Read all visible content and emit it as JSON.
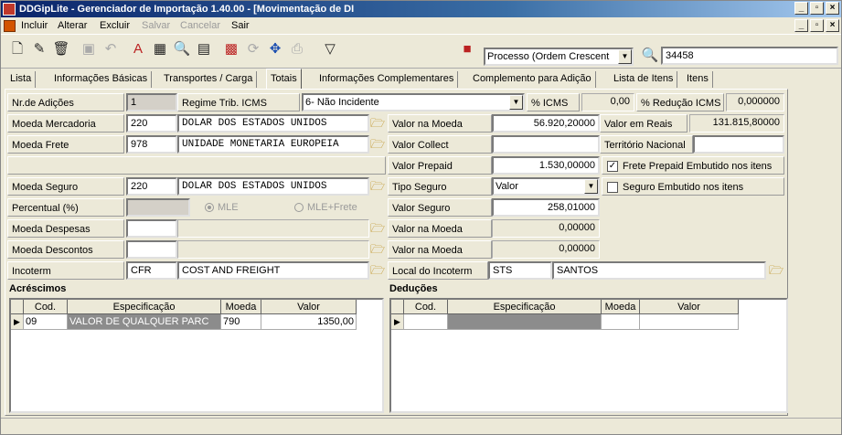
{
  "window": {
    "title": "DDGipLite - Gerenciador de Importação 1.40.00 - [Movimentação de DI",
    "minimize": "_",
    "restore": "▫",
    "close": "×"
  },
  "menu": {
    "items": [
      "Incluir",
      "Alterar",
      "Excluir",
      "Salvar",
      "Cancelar",
      "Sair"
    ]
  },
  "toolbar": {
    "sort_select": "Processo (Ordem Crescent",
    "search_value": "34458"
  },
  "tabs": [
    "Lista",
    "Informações Básicas",
    "Transportes / Carga",
    "Totais",
    "Informações Complementares",
    "Complemento para Adição",
    "Lista de Itens",
    "Itens"
  ],
  "form": {
    "nr_adicoes_label": "Nr.de Adições",
    "nr_adicoes_value": "1",
    "regime_label": "Regime Trib. ICMS",
    "regime_value": "6- Não Incidente",
    "icms_label": "% ICMS",
    "icms_value": "0,00",
    "reducao_label": "% Redução ICMS",
    "reducao_value": "0,000000",
    "moeda_mercadoria_label": "Moeda Mercadoria",
    "moeda_mercadoria_code": "220",
    "moeda_mercadoria_name": "DOLAR DOS ESTADOS UNIDOS",
    "valor_moeda_label": "Valor na Moeda",
    "valor_moeda_value": "56.920,20000",
    "valor_reais_label": "Valor em Reais",
    "valor_reais_value": "131.815,80000",
    "moeda_frete_label": "Moeda Frete",
    "moeda_frete_code": "978",
    "moeda_frete_name": "UNIDADE MONETARIA EUROPEIA",
    "valor_collect_label": "Valor Collect",
    "valor_collect_value": "",
    "territorio_label": "Território Nacional",
    "territorio_value": "",
    "valor_prepaid_label": "Valor Prepaid",
    "valor_prepaid_value": "1.530,00000",
    "frete_embutido_label": "Frete Prepaid Embutido nos itens",
    "frete_embutido_mark": "✓",
    "moeda_seguro_label": "Moeda Seguro",
    "moeda_seguro_code": "220",
    "moeda_seguro_name": "DOLAR DOS ESTADOS UNIDOS",
    "tipo_seguro_label": "Tipo Seguro",
    "tipo_seguro_value": "Valor",
    "seguro_embutido_label": "Seguro Embutido nos itens",
    "percentual_label": "Percentual (%)",
    "mle_label": "MLE",
    "mle_frete_label": "MLE+Frete",
    "valor_seguro_label": "Valor Seguro",
    "valor_seguro_value": "258,01000",
    "moeda_despesas_label": "Moeda Despesas",
    "despesas_valor_label": "Valor na Moeda",
    "despesas_valor_value": "0,00000",
    "moeda_descontos_label": "Moeda Descontos",
    "descontos_valor_label": "Valor na Moeda",
    "descontos_valor_value": "0,00000",
    "incoterm_label": "Incoterm",
    "incoterm_code": "CFR",
    "incoterm_name": "COST AND FREIGHT",
    "local_incoterm_label": "Local do Incoterm",
    "local_incoterm_code": "STS",
    "local_incoterm_name": "SANTOS"
  },
  "acrescimos": {
    "title": "Acréscimos",
    "headers": [
      "Cod.",
      "Especificação",
      "Moeda",
      "Valor"
    ],
    "rows": [
      {
        "indicator": "▶",
        "cod": "09",
        "espec": "VALOR DE QUALQUER PARC",
        "moeda": "790",
        "valor": "1350,00"
      }
    ]
  },
  "deducoes": {
    "title": "Deduções",
    "headers": [
      "Cod.",
      "Especificação",
      "Moeda",
      "Valor"
    ],
    "rows": [
      {
        "indicator": "▶",
        "cod": "",
        "espec": "",
        "moeda": "",
        "valor": ""
      }
    ]
  }
}
